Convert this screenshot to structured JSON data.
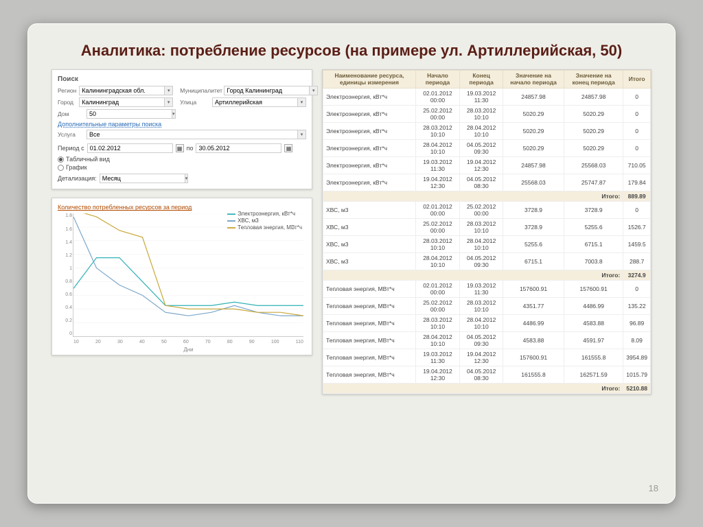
{
  "title": "Аналитика: потребление ресурсов (на примере ул. Артиллерийская, 50)",
  "page_number": "18",
  "search": {
    "heading": "Поиск",
    "region_lbl": "Регион",
    "region": "Калининградская обл.",
    "municipality_lbl": "Муниципалитет",
    "municipality": "Город Калининград",
    "city_lbl": "Город",
    "city": "Калининград",
    "street_lbl": "Улица",
    "street": "Артиллерийская",
    "house_lbl": "Дом",
    "house": "50",
    "extra_params": "Дополнительные параметры поиска",
    "service_lbl": "Услуга",
    "service": "Все",
    "period_lbl": "Период с",
    "period_from": "01.02.2012",
    "period_to_lbl": "по",
    "period_to": "30.05.2012",
    "view_table": "Табличный вид",
    "view_chart": "График",
    "detail_lbl": "Детализация:",
    "detail": "Месяц"
  },
  "chart": {
    "title": "Количество потребленных ресурсов за период",
    "legend": [
      "Электроэнергия, кВт*ч",
      "ХВС, м3",
      "Тепловая энергия, МВт*ч"
    ],
    "xlabel": "Дни",
    "xticks": [
      "10",
      "20",
      "30",
      "40",
      "50",
      "60",
      "70",
      "80",
      "90",
      "100",
      "110"
    ],
    "yticks": [
      "1.8",
      "1.6",
      "1.4",
      "1.2",
      "1",
      "0.8",
      "0.6",
      "0.4",
      "0.2",
      "0"
    ]
  },
  "chart_data": {
    "type": "line",
    "xlabel": "Дни",
    "ylabel": "",
    "x": [
      10,
      20,
      30,
      40,
      50,
      60,
      70,
      80,
      90,
      100,
      110
    ],
    "series": [
      {
        "name": "Электроэнергия, кВт*ч",
        "color": "#2fb1b5",
        "values": [
          0.7,
          1.15,
          1.15,
          0.8,
          0.45,
          0.45,
          0.45,
          0.5,
          0.45,
          0.45,
          0.45
        ]
      },
      {
        "name": "ХВС, м3",
        "color": "#7ca6c9",
        "values": [
          1.75,
          1.0,
          0.75,
          0.6,
          0.35,
          0.3,
          0.35,
          0.45,
          0.35,
          0.3,
          0.3
        ]
      },
      {
        "name": "Тепловая энергия, МВт*ч",
        "color": "#c9a838",
        "values": [
          1.85,
          1.75,
          1.55,
          1.45,
          0.45,
          0.4,
          0.4,
          0.4,
          0.35,
          0.35,
          0.3
        ]
      }
    ],
    "ylim": [
      0,
      1.8
    ]
  },
  "table": {
    "headers": [
      "Наименование ресурса, единицы измерения",
      "Начало периода",
      "Конец периода",
      "Значение на начало периода",
      "Значение на конец периода",
      "Итого"
    ],
    "sections": [
      {
        "rows": [
          [
            "Электроэнергия, кВт*ч",
            "02.01.2012 00:00",
            "19.03.2012 11:30",
            "24857.98",
            "24857.98",
            "0"
          ],
          [
            "Электроэнергия, кВт*ч",
            "25.02.2012 00:00",
            "28.03.2012 10:10",
            "5020.29",
            "5020.29",
            "0"
          ],
          [
            "Электроэнергия, кВт*ч",
            "28.03.2012 10:10",
            "28.04.2012 10:10",
            "5020.29",
            "5020.29",
            "0"
          ],
          [
            "Электроэнергия, кВт*ч",
            "28.04.2012 10:10",
            "04.05.2012 09:30",
            "5020.29",
            "5020.29",
            "0"
          ],
          [
            "Электроэнергия, кВт*ч",
            "19.03.2012 11:30",
            "19.04.2012 12:30",
            "24857.98",
            "25568.03",
            "710.05"
          ],
          [
            "Электроэнергия, кВт*ч",
            "19.04.2012 12:30",
            "04.05.2012 08:30",
            "25568.03",
            "25747.87",
            "179.84"
          ]
        ],
        "subtotal_label": "Итого:",
        "subtotal": "889.89"
      },
      {
        "rows": [
          [
            "ХВС, м3",
            "02.01.2012 00:00",
            "25.02.2012 00:00",
            "3728.9",
            "3728.9",
            "0"
          ],
          [
            "ХВС, м3",
            "25.02.2012 00:00",
            "28.03.2012 10:10",
            "3728.9",
            "5255.6",
            "1526.7"
          ],
          [
            "ХВС, м3",
            "28.03.2012 10:10",
            "28.04.2012 10:10",
            "5255.6",
            "6715.1",
            "1459.5"
          ],
          [
            "ХВС, м3",
            "28.04.2012 10:10",
            "04.05.2012 09:30",
            "6715.1",
            "7003.8",
            "288.7"
          ]
        ],
        "subtotal_label": "Итого:",
        "subtotal": "3274.9"
      },
      {
        "rows": [
          [
            "Тепловая энергия, МВт*ч",
            "02.01.2012 00:00",
            "19.03.2012 11:30",
            "157600.91",
            "157600.91",
            "0"
          ],
          [
            "Тепловая энергия, МВт*ч",
            "25.02.2012 00:00",
            "28.03.2012 10:10",
            "4351.77",
            "4486.99",
            "135.22"
          ],
          [
            "Тепловая энергия, МВт*ч",
            "28.03.2012 10:10",
            "28.04.2012 10:10",
            "4486.99",
            "4583.88",
            "96.89"
          ],
          [
            "Тепловая энергия, МВт*ч",
            "28.04.2012 10:10",
            "04.05.2012 09:30",
            "4583.88",
            "4591.97",
            "8.09"
          ],
          [
            "Тепловая энергия, МВт*ч",
            "19.03.2012 11:30",
            "19.04.2012 12:30",
            "157600.91",
            "161555.8",
            "3954.89"
          ],
          [
            "Тепловая энергия, МВт*ч",
            "19.04.2012 12:30",
            "04.05.2012 08:30",
            "161555.8",
            "162571.59",
            "1015.79"
          ]
        ],
        "subtotal_label": "Итого:",
        "subtotal": "5210.88"
      }
    ]
  }
}
